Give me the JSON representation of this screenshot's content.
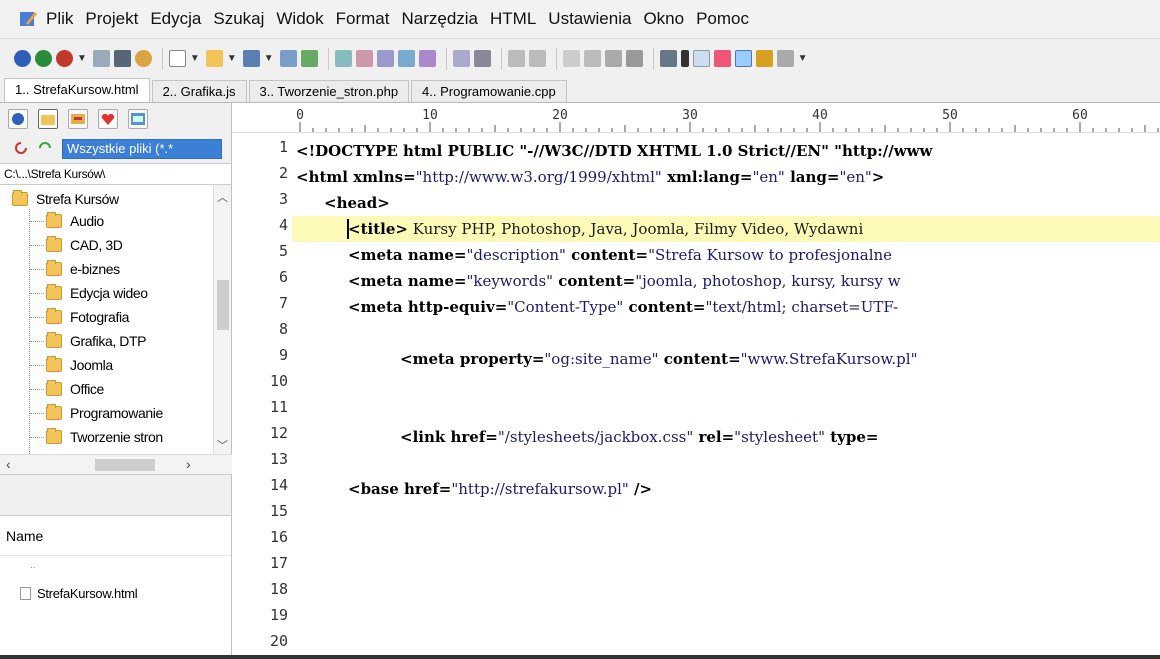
{
  "menu": [
    "Plik",
    "Projekt",
    "Edycja",
    "Szukaj",
    "Widok",
    "Format",
    "Narzędzia",
    "HTML",
    "Ustawienia",
    "Okno",
    "Pomoc"
  ],
  "tabs": [
    {
      "label": "1.. StrefaKursow.html",
      "active": true
    },
    {
      "label": "2.. Grafika.js",
      "active": false
    },
    {
      "label": "3.. Tworzenie_stron.php",
      "active": false
    },
    {
      "label": "4.. Programowanie.cpp",
      "active": false
    }
  ],
  "sidebar": {
    "filter": "Wszystkie pliki (*.*",
    "path": "C:\\...\\Strefa Kursów\\",
    "tree_root": "Strefa Kursów",
    "tree_items": [
      "Audio",
      "CAD, 3D",
      "e-biznes",
      "Edycja wideo",
      "Fotografia",
      "Grafika, DTP",
      "Joomla",
      "Office",
      "Programowanie",
      "Tworzenie stron"
    ],
    "name_header": "Name",
    "parent_dir": "..",
    "files": [
      "StrefaKursow.html"
    ]
  },
  "ruler": [
    "0",
    "10",
    "20",
    "30",
    "40",
    "50",
    "60"
  ],
  "line_numbers": [
    "1",
    "2",
    "3",
    "4",
    "5",
    "6",
    "7",
    "8",
    "9",
    "10",
    "11",
    "12",
    "13",
    "14",
    "15",
    "16",
    "17",
    "18",
    "19",
    "20"
  ],
  "code": {
    "l1": "<!DOCTYPE html PUBLIC \"-//W3C//DTD XHTML 1.0 Strict//EN\" \"http://www",
    "l2_open": "<html ",
    "l2_a1": "xmlns=",
    "l2_v1": "\"http://www.w3.org/1999/xhtml\"",
    "l2_a2": " xml:lang=",
    "l2_v2": "\"en\"",
    "l2_a3": " lang=",
    "l2_v3": "\"en\"",
    "l2_close": ">",
    "l3": "<head>",
    "l4_tag": "<title>",
    "l4_text": " Kursy PHP, Photoshop, Java, Joomla, Filmy Video, Wydawni",
    "l5_open": "<meta ",
    "l5_a1": "name=",
    "l5_v1": "\"description\"",
    "l5_a2": " content=",
    "l5_v2": "\"Strefa Kursow to profesjonalne",
    "l6_open": "<meta ",
    "l6_a1": "name=",
    "l6_v1": "\"keywords\"",
    "l6_a2": " content=",
    "l6_v2": "\"joomla, photoshop, kursy, kursy w",
    "l7_open": "<meta ",
    "l7_a1": "http-equiv=",
    "l7_v1": "\"Content-Type\"",
    "l7_a2": " content=",
    "l7_v2": "\"text/html; charset=UTF-",
    "l9_open": "<meta ",
    "l9_a1": "property=",
    "l9_v1": "\"og:site_name\"",
    "l9_a2": " content=",
    "l9_v2": "\"www.StrefaKursow.pl\"",
    "l12_open": "<link ",
    "l12_a1": "href=",
    "l12_v1": "\"/stylesheets/jackbox.css\"",
    "l12_a2": " rel=",
    "l12_v2": "\"stylesheet\"",
    "l12_a3": " type=",
    "l14_open": "<base ",
    "l14_a1": "href=",
    "l14_v1": "\"http://strefakursow.pl\"",
    "l14_close": " />"
  },
  "colors": {
    "accent": "#3c7fd6",
    "highlight": "#fdfab7",
    "folder": "#f3c45a"
  }
}
